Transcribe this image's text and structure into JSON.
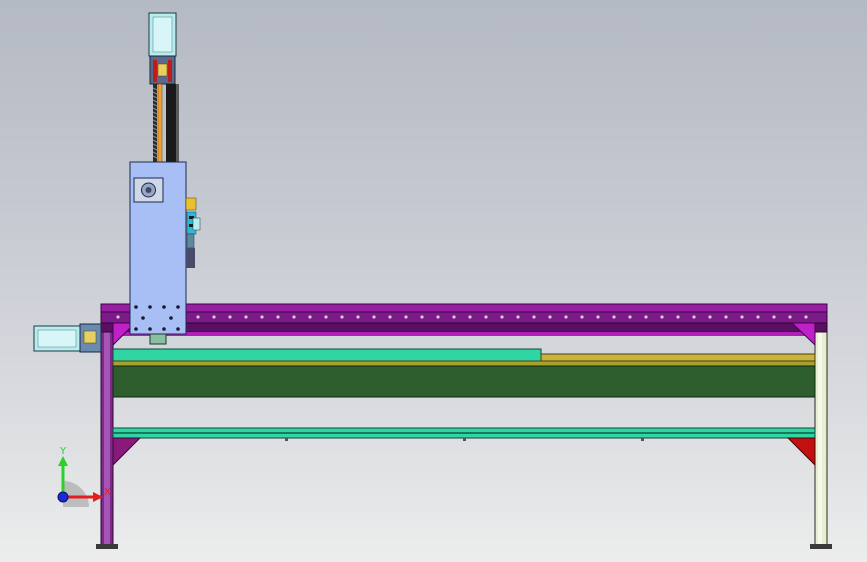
{
  "view": {
    "background_top": "#b4b9c3",
    "background_bottom": "#eceded"
  },
  "colors": {
    "beam_purple": "#9a1ea3",
    "beam_purple_dark": "#5a0f62",
    "carriage_blue": "#a8bff5",
    "motor_cyan": "#b8ecef",
    "rail_teal": "#2fd6a4",
    "rail_yellow": "#c9b33a",
    "bed_green": "#2e5e2e",
    "leg_pale": "#e6f0d0",
    "bracket_magenta": "#c020c8",
    "bracket_red": "#c01010",
    "screw_orange": "#f0a030"
  },
  "triad": {
    "y_label": "Y",
    "x_label": "X",
    "y_color": "#2bd12b",
    "x_color": "#e02020",
    "origin_color": "#1a2ad8"
  }
}
